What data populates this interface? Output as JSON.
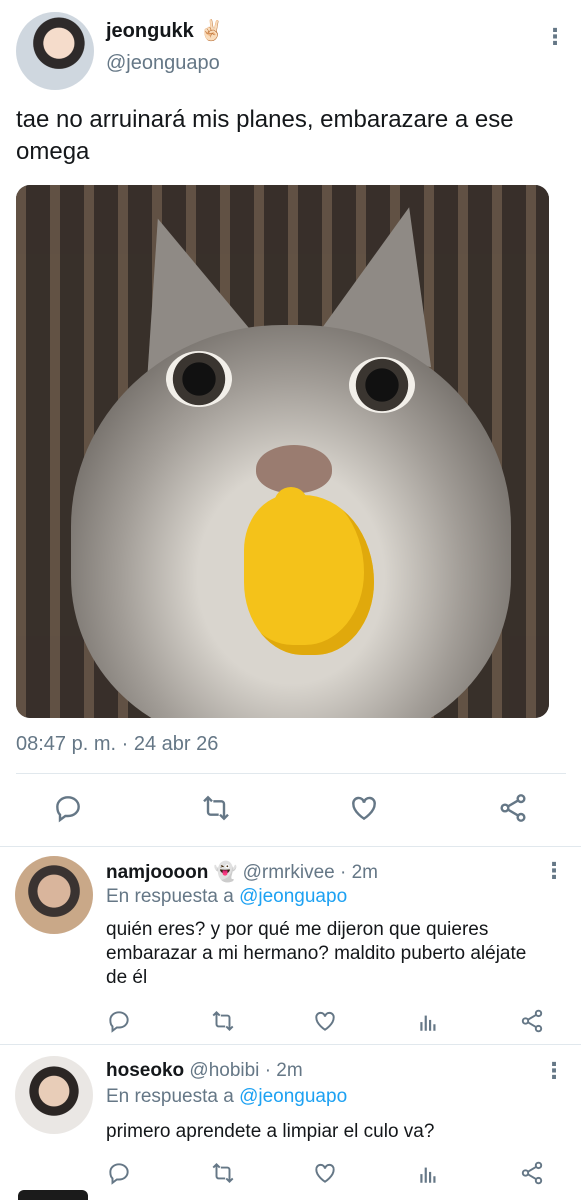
{
  "tweet": {
    "display_name": "jeongukk ✌🏻",
    "handle": "@jeonguapo",
    "text": "tae no arruinará mis planes, embarazare a ese omega",
    "image_alt": "",
    "timestamp": "08:47 p. m. · 24 abr 26",
    "icons": [
      "reply-icon",
      "retweet-icon",
      "like-icon",
      "share-icon",
      "more-icon"
    ]
  },
  "replies": [
    {
      "display_name": "namjoooon 👻",
      "handle": "@rmrkivee",
      "time": "· 2m",
      "in_reply_prefix": "En respuesta a",
      "in_reply_handle": "@jeonguapo",
      "text": "quién eres? y por qué me dijeron que quieres embarazar a mi hermano? maldito puberto aléjate de él"
    },
    {
      "display_name": "hoseoko",
      "handle": "@hobibi",
      "time": "· 2m",
      "in_reply_prefix": "En respuesta a",
      "in_reply_handle": "@jeonguapo",
      "text": "primero aprendete a limpiar el culo va?"
    }
  ],
  "colors": {
    "accent": "#1da1f2",
    "secondary_text": "#657786",
    "divider": "#e1e8ed"
  }
}
